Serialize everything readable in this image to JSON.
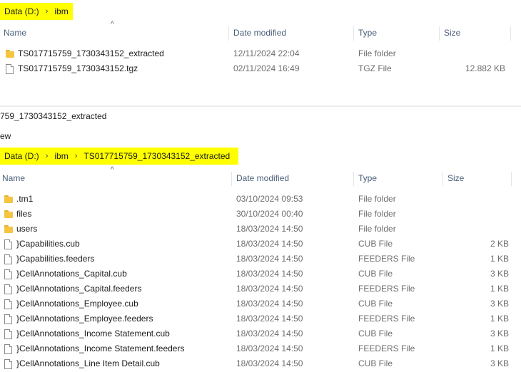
{
  "top_window": {
    "breadcrumb": [
      "Data (D:)",
      "ibm"
    ],
    "columns": {
      "name": "Name",
      "date": "Date modified",
      "type": "Type",
      "size": "Size"
    },
    "sort_indicator": "^",
    "rows": [
      {
        "icon": "folder-icon",
        "name": "TS017715759_1730343152_extracted",
        "date": "12/11/2024 22:04",
        "type": "File folder",
        "size": ""
      },
      {
        "icon": "file-icon",
        "name": "TS017715759_1730343152.tgz",
        "date": "02/11/2024 16:49",
        "type": "TGZ File",
        "size": "12.882 KB"
      }
    ]
  },
  "bottom_window": {
    "title_fragment": "759_1730343152_extracted",
    "ribbon_fragment": "ew",
    "breadcrumb": [
      "Data (D:)",
      "ibm",
      "TS017715759_1730343152_extracted"
    ],
    "columns": {
      "name": "Name",
      "date": "Date modified",
      "type": "Type",
      "size": "Size"
    },
    "sort_indicator": "^",
    "rows": [
      {
        "icon": "folder-icon",
        "name": ".tm1",
        "date": "03/10/2024 09:53",
        "type": "File folder",
        "size": ""
      },
      {
        "icon": "folder-icon",
        "name": "files",
        "date": "30/10/2024 00:40",
        "type": "File folder",
        "size": ""
      },
      {
        "icon": "folder-icon",
        "name": "users",
        "date": "18/03/2024 14:50",
        "type": "File folder",
        "size": ""
      },
      {
        "icon": "file-icon",
        "name": "}Capabilities.cub",
        "date": "18/03/2024 14:50",
        "type": "CUB File",
        "size": "2 KB"
      },
      {
        "icon": "file-icon",
        "name": "}Capabilities.feeders",
        "date": "18/03/2024 14:50",
        "type": "FEEDERS File",
        "size": "1 KB"
      },
      {
        "icon": "file-icon",
        "name": "}CellAnnotations_Capital.cub",
        "date": "18/03/2024 14:50",
        "type": "CUB File",
        "size": "3 KB"
      },
      {
        "icon": "file-icon",
        "name": "}CellAnnotations_Capital.feeders",
        "date": "18/03/2024 14:50",
        "type": "FEEDERS File",
        "size": "1 KB"
      },
      {
        "icon": "file-icon",
        "name": "}CellAnnotations_Employee.cub",
        "date": "18/03/2024 14:50",
        "type": "CUB File",
        "size": "3 KB"
      },
      {
        "icon": "file-icon",
        "name": "}CellAnnotations_Employee.feeders",
        "date": "18/03/2024 14:50",
        "type": "FEEDERS File",
        "size": "1 KB"
      },
      {
        "icon": "file-icon",
        "name": "}CellAnnotations_Income Statement.cub",
        "date": "18/03/2024 14:50",
        "type": "CUB File",
        "size": "3 KB"
      },
      {
        "icon": "file-icon",
        "name": "}CellAnnotations_Income Statement.feeders",
        "date": "18/03/2024 14:50",
        "type": "FEEDERS File",
        "size": "1 KB"
      },
      {
        "icon": "file-icon",
        "name": "}CellAnnotations_Line Item Detail.cub",
        "date": "18/03/2024 14:50",
        "type": "CUB File",
        "size": "3 KB"
      }
    ]
  },
  "colors": {
    "highlight": "#ffff00",
    "header_text": "#4c607a",
    "folder": "#f5c441"
  }
}
